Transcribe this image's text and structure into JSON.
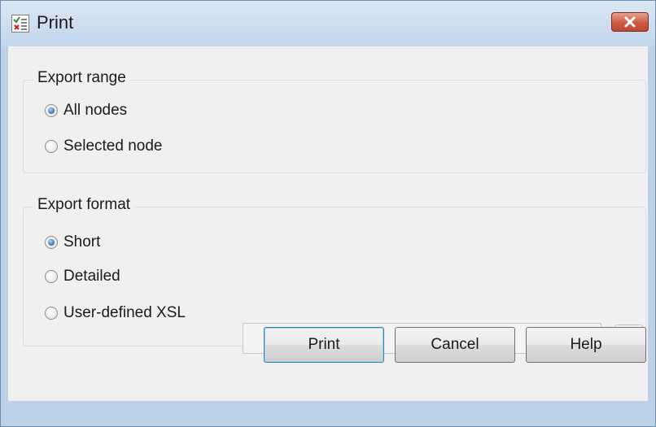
{
  "window": {
    "title": "Print"
  },
  "export_range": {
    "title": "Export range",
    "options": [
      {
        "label": "All nodes",
        "checked": true
      },
      {
        "label": "Selected node",
        "checked": false
      }
    ]
  },
  "export_format": {
    "title": "Export format",
    "options": [
      {
        "label": "Short",
        "checked": true
      },
      {
        "label": "Detailed",
        "checked": false
      },
      {
        "label": "User-defined XSL",
        "checked": false
      }
    ],
    "xsl_path": {
      "value": "",
      "placeholder": "",
      "enabled": false
    },
    "browse_label": "..."
  },
  "buttons": {
    "print": "Print",
    "cancel": "Cancel",
    "help": "Help"
  },
  "icons": {
    "app": "document-checklist-icon",
    "close": "close-x-icon"
  },
  "colors": {
    "titlebar": "#c9dbef",
    "close_button": "#c9533c",
    "radio_selected": "#2a6fb9",
    "default_button_border": "#3c7fb1"
  }
}
